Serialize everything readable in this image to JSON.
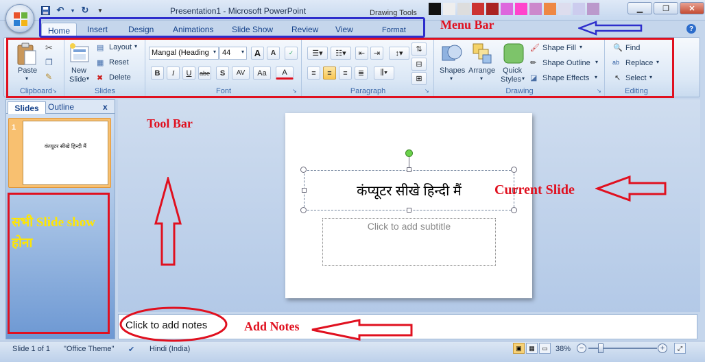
{
  "window": {
    "title": "Presentation1 - Microsoft PowerPoint",
    "context_tab_group": "Drawing Tools",
    "minimize": "0",
    "maximize": "1",
    "close": "r"
  },
  "tabs": [
    "Home",
    "Insert",
    "Design",
    "Animations",
    "Slide Show",
    "Review",
    "View",
    "Format"
  ],
  "ribbon": {
    "clipboard": {
      "label": "Clipboard",
      "paste": "Paste"
    },
    "slides": {
      "label": "Slides",
      "new_slide_line1": "New",
      "new_slide_line2": "Slide",
      "layout": "Layout",
      "reset": "Reset",
      "delete": "Delete"
    },
    "font": {
      "label": "Font",
      "font_name": "Mangal (Heading",
      "font_size": "44",
      "grow": "A",
      "shrink": "A",
      "bold": "B",
      "italic": "I",
      "underline": "U",
      "strike": "abe",
      "shadow": "S",
      "spacing": "AV",
      "case": "Aa",
      "color": "A"
    },
    "paragraph": {
      "label": "Paragraph"
    },
    "drawing": {
      "label": "Drawing",
      "shapes": "Shapes",
      "arrange": "Arrange",
      "quick_styles_1": "Quick",
      "quick_styles_2": "Styles",
      "shape_fill": "Shape Fill",
      "shape_outline": "Shape Outline",
      "shape_effects": "Shape Effects"
    },
    "editing": {
      "label": "Editing",
      "find": "Find",
      "replace": "Replace",
      "select": "Select"
    }
  },
  "left_pane": {
    "slides_tab": "Slides",
    "outline_tab": "Outline",
    "close": "x",
    "thumb_number": "1",
    "thumb_text": "कंप्यूटर सीखे हिन्दी मैं"
  },
  "slide": {
    "title": "कंप्यूटर सीखे हिन्दी मैं",
    "subtitle_placeholder": "Click to add subtitle"
  },
  "notes": {
    "placeholder": "Click to add notes"
  },
  "status": {
    "slide_count": "Slide 1 of 1",
    "theme": "\"Office Theme\"",
    "language": "Hindi (India)",
    "zoom": "38%"
  },
  "annotations": {
    "menu_bar": "Menu Bar",
    "tool_bar": "Tool Bar",
    "current_slide": "Current Slide",
    "add_notes": "Add Notes",
    "slide_show_1": "सभी Slide show",
    "slide_show_2": "होना"
  },
  "colors": {
    "annotation_red": "#e0101f",
    "annotation_blue": "#2d2dcc",
    "annotation_yellow": "#ffe600",
    "ribbon_text": "#15428b"
  }
}
